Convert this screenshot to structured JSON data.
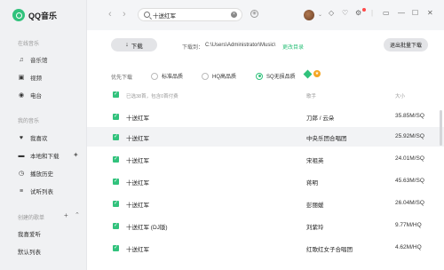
{
  "app": {
    "name": "QQ音乐"
  },
  "sidebar": {
    "online_title": "在线音乐",
    "online_items": [
      {
        "label": "音乐馆",
        "icon": "music-note-icon"
      },
      {
        "label": "视频",
        "icon": "video-icon"
      },
      {
        "label": "电台",
        "icon": "radio-icon"
      }
    ],
    "my_title": "我的音乐",
    "my_items": [
      {
        "label": "我喜欢",
        "icon": "heart-icon"
      },
      {
        "label": "本地和下载",
        "icon": "monitor-icon"
      },
      {
        "label": "播放历史",
        "icon": "clock-icon"
      },
      {
        "label": "试听列表",
        "icon": "list-icon"
      }
    ],
    "created_title": "创建的歌单",
    "created_items": [
      {
        "label": "我喜爱听"
      },
      {
        "label": "默认列表"
      }
    ]
  },
  "topbar": {
    "search_value": "十送红军",
    "search_placeholder": "",
    "clear_glyph": "×",
    "back_glyph": "‹",
    "forward_glyph": "›",
    "mic_glyph": "◉",
    "avatar_chevron": "⌄",
    "icons": {
      "vip": "◇",
      "skin": "♡",
      "settings": "⚙",
      "mini": "▭",
      "minimize": "—",
      "maximize": "☐",
      "close": "✕"
    }
  },
  "download_bar": {
    "button_label": "下载",
    "button_icon": "↓",
    "path_label": "下载到：",
    "path_value": "C:\\Users\\Administrator\\Music\\",
    "change_label": "更改目录",
    "exit_label": "退出批量下载"
  },
  "quality": {
    "label": "优先下载",
    "options": [
      {
        "label": "标准品质",
        "selected": false
      },
      {
        "label": "HQ高品质",
        "selected": false
      },
      {
        "label": "SQ无损品质",
        "selected": true
      }
    ],
    "badge": "★"
  },
  "table": {
    "select_all_label": "已选38首，包含0首付费",
    "col_artist": "歌手",
    "col_size": "大小",
    "check_glyph": "✓",
    "rows": [
      {
        "title": "十送红军",
        "artist": "刀郎 / 云朵",
        "size": "35.85M/SQ"
      },
      {
        "title": "十送红军",
        "artist": "中央乐团合唱团",
        "size": "25.92M/SQ"
      },
      {
        "title": "十送红军",
        "artist": "宋祖英",
        "size": "24.01M/SQ"
      },
      {
        "title": "十送红军",
        "artist": "蒋明",
        "size": "45.63M/SQ"
      },
      {
        "title": "十送红军",
        "artist": "彭丽媛",
        "size": "26.04M/SQ"
      },
      {
        "title": "十送红军 (DJ版)",
        "artist": "刘紫玲",
        "size": "9.77M/HQ"
      },
      {
        "title": "十送红军",
        "artist": "红歌红女子合唱团",
        "size": "4.62M/HQ"
      }
    ]
  },
  "colors": {
    "accent": "#31c27c",
    "sidebar_bg": "#f0f1f3",
    "row_alt": "#f2f3f5"
  }
}
